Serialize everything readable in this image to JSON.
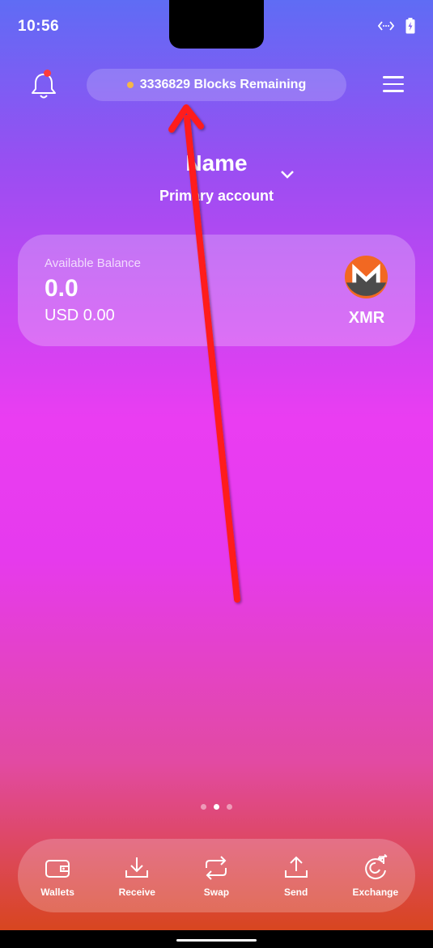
{
  "status_bar": {
    "time": "10:56"
  },
  "sync": {
    "text": "3336829 Blocks Remaining",
    "dot_color": "#f5b648"
  },
  "wallet": {
    "name": "Name",
    "account": "Primary account"
  },
  "balance": {
    "label": "Available Balance",
    "value": "0.0",
    "fiat": "USD 0.00",
    "currency": "XMR",
    "logo_icon": "monero-logo-icon"
  },
  "pager": {
    "count": 3,
    "active_index": 1
  },
  "bottom_nav": [
    {
      "label": "Wallets",
      "icon": "wallet-icon"
    },
    {
      "label": "Receive",
      "icon": "download-icon"
    },
    {
      "label": "Swap",
      "icon": "swap-icon"
    },
    {
      "label": "Send",
      "icon": "upload-icon"
    },
    {
      "label": "Exchange",
      "icon": "exchange-icon"
    }
  ],
  "annotation": {
    "color": "#ff1f1f"
  },
  "colors": {
    "monero_orange": "#f26822",
    "monero_gray": "#4c4c4c",
    "notification_dot": "#ff3b3b"
  }
}
